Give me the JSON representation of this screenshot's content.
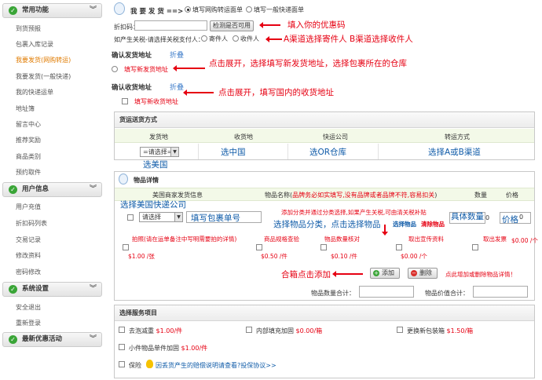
{
  "sidebar": {
    "sec1": "常用功能",
    "sec1_items": [
      "到货预报",
      "包裹入库记录",
      "我要发货(网购转运)",
      "我要发货(一般快递)",
      "我的快递运单",
      "地址簿",
      "留言中心",
      "推荐奖励",
      "商品类别",
      "预约取件"
    ],
    "sec2": "用户信息",
    "sec2_items": [
      "用户充值",
      "折扣码列表",
      "交易记录",
      "修改资料",
      "密码修改"
    ],
    "sec3": "系统设置",
    "sec3_items": [
      "安全退出",
      "重新登录"
    ],
    "sec4": "最新优惠活动"
  },
  "header": {
    "title": "我 要 发 货 ==>",
    "opt1": "填写网购转运面单",
    "opt2": "填写一般快递面单"
  },
  "discount": {
    "label": "折扣码：",
    "check_button": "检测是否可用",
    "annotation": "填入你的优惠码"
  },
  "payer": {
    "label": "如产生关税-请选择关税支付人：",
    "opt_sender": "寄件人",
    "opt_receiver": "收件人",
    "annotation": "A渠道选择寄件人  B渠道选择收件人"
  },
  "sender_addr": {
    "title": "确认发货地址",
    "toggle": "折叠",
    "new": "填写新发货地址",
    "annotation": "点击展开，选择填写新发货地址，选择包裹所在的仓库"
  },
  "receiver_addr": {
    "title": "确认收货地址",
    "toggle": "折叠",
    "new": "填写新收货地址",
    "annotation": "点击展开，填写国内的收货地址"
  },
  "shipping": {
    "title": "货运送货方式",
    "cols": [
      "发货地",
      "收货地",
      "快运公司",
      "转运方式"
    ],
    "select_placeholder": "=请选择=",
    "cell_receiver": "选中国",
    "cell_company": "选OR仓库",
    "cell_method": "选择A或B渠道",
    "below_annotation": "选美国"
  },
  "items": {
    "title": "物品详情",
    "col_info": "美国商家发货信息",
    "col_name_prefix": "物品名称(",
    "col_name_warning": "品牌务必如实填写,没有品牌或者品牌不符,容易扣关",
    "col_name_suffix": ")",
    "col_qty": "数量",
    "col_price": "价格",
    "select_us_courier": "选择美国快递公司",
    "select_placeholder": "请选择",
    "fill_tracking": "填写包裹单号",
    "category_note": "添加分类并通过分类选择,如果产生关税,可由清关税补贴",
    "select_category": "选择物品分类，点击选择物品",
    "link_select_item": "选择物品",
    "link_clear_item": "清除物品",
    "qty_label": "具体数量",
    "qty_value": "0",
    "price_label": "价格",
    "price_value": "0",
    "services": [
      {
        "label": "拍照(请在运单备注中写明需要拍的详情)",
        "price": "$1.00 /张"
      },
      {
        "label": "商品规格查验",
        "price": "$0.50 /件"
      },
      {
        "label": "物品数量核对",
        "price": "$0.10 /件"
      },
      {
        "label": "取出宣传资料",
        "price": "$0.00 /个"
      },
      {
        "label": "取出发票",
        "price": "$0.00 /个"
      }
    ],
    "combine_annotation": "合箱点击添加",
    "add_button": "添加",
    "delete_button": "删除",
    "tip": "点此增加或删除物品详情！",
    "total_qty_label": "物品数量合计：",
    "total_price_label": "物品价值合计："
  },
  "services": {
    "title": "选择服务项目",
    "row1": [
      {
        "label": "去泡减重",
        "price": "$1.00/件"
      },
      {
        "label": "内部填充加固",
        "price": "$0.00/箱"
      },
      {
        "label": "更换新包装箱",
        "price": "$1.50/箱"
      }
    ],
    "row2": {
      "label": "小件物品单件加固",
      "price": "$1.00/件"
    },
    "insurance": "保险",
    "insurance_note": "因丢货产生的赔偿说明请查看?投保协议>>"
  }
}
